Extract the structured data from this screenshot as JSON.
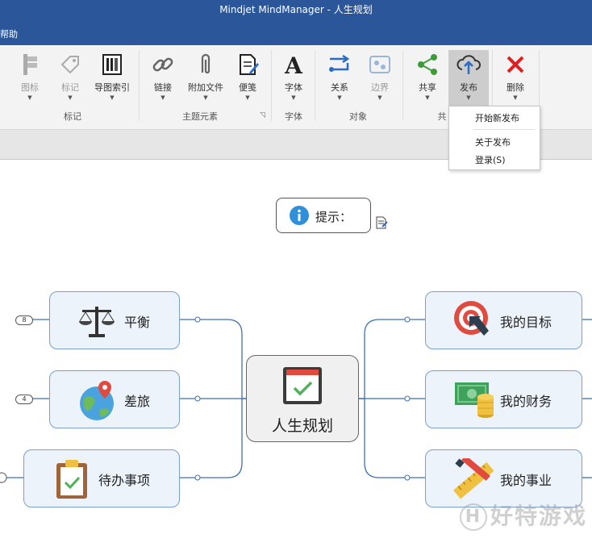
{
  "window": {
    "title": "Mindjet MindManager - 人生规划"
  },
  "menu": {
    "help_label": "帮助"
  },
  "ribbon": {
    "buttons": {
      "icon": "图标",
      "tag": "标记",
      "index": "导图索引",
      "link": "链接",
      "attach": "附加文件",
      "note": "便笺",
      "font": "字体",
      "relation": "关系",
      "boundary": "边界",
      "share": "共享",
      "publish": "发布",
      "delete": "删除"
    },
    "groups": {
      "markers": "标记",
      "topic_elements": "主题元素",
      "font": "字体",
      "objects": "对象",
      "share_partial": "共"
    }
  },
  "publish_menu": {
    "start": "开始新发布",
    "about": "关于发布",
    "login": "登录(S)"
  },
  "mindmap": {
    "callout": "提示：",
    "central": "人生规划",
    "left_topics": [
      "平衡",
      "差旅",
      "待办事项"
    ],
    "right_topics": [
      "我的目标",
      "我的财务",
      "我的事业"
    ],
    "badges": [
      "8",
      "4"
    ]
  },
  "watermark": "好特游戏",
  "colors": {
    "title_bar": "#2b579a",
    "ribbon": "#f3f3f3",
    "topic_fill": "#edf3fb",
    "topic_border": "#7a9fcc",
    "connector": "#3f6fb0",
    "delete_red": "#e02020",
    "share_green": "#3e9b3a"
  }
}
